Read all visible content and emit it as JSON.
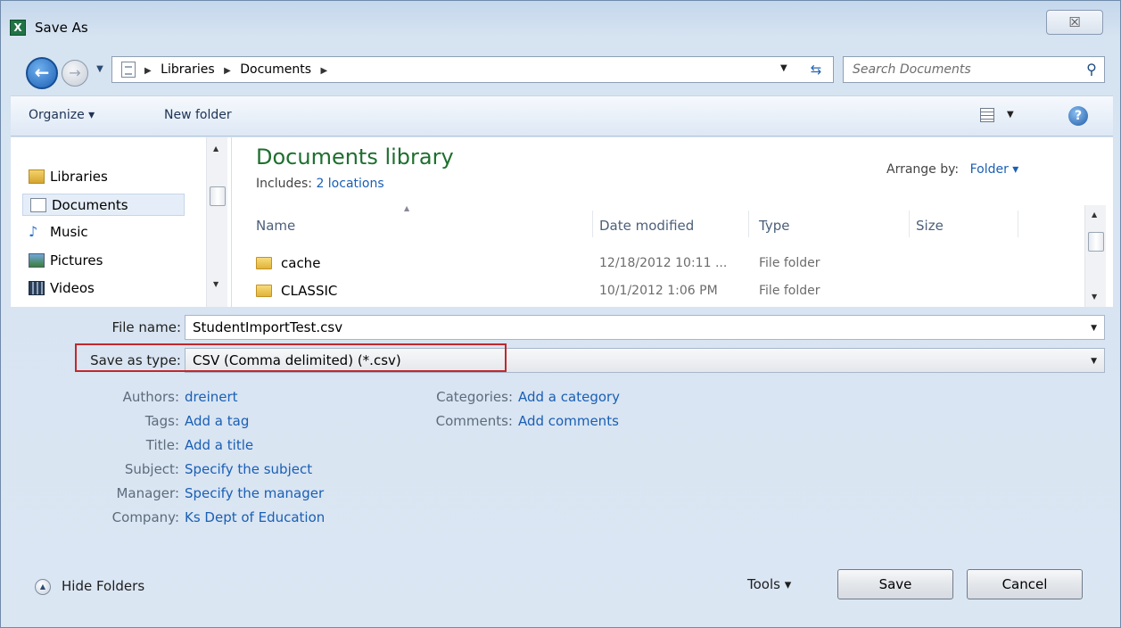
{
  "window": {
    "title": "Save As",
    "close_label": "☒",
    "app_icon_letter": "X"
  },
  "address": {
    "crumbs": [
      "Libraries",
      "Documents"
    ],
    "search_placeholder": "Search Documents"
  },
  "toolbar": {
    "organize_label": "Organize ▾",
    "new_folder_label": "New folder"
  },
  "nav": {
    "items": [
      {
        "label": "Libraries",
        "icon": "library-icon"
      },
      {
        "label": "Documents",
        "icon": "documents-icon",
        "selected": true
      },
      {
        "label": "Music",
        "icon": "music-icon"
      },
      {
        "label": "Pictures",
        "icon": "pictures-icon"
      },
      {
        "label": "Videos",
        "icon": "videos-icon"
      }
    ]
  },
  "library": {
    "title": "Documents library",
    "includes_label": "Includes:",
    "includes_link": "2 locations",
    "arrange_label": "Arrange by:",
    "arrange_value": "Folder ▾"
  },
  "columns": {
    "name": "Name",
    "date_modified": "Date modified",
    "type": "Type",
    "size": "Size"
  },
  "files": [
    {
      "name": "cache",
      "date": "12/18/2012 10:11 ...",
      "type": "File folder"
    },
    {
      "name": "CLASSIC",
      "date": "10/1/2012 1:06 PM",
      "type": "File folder"
    }
  ],
  "form": {
    "file_name_label": "File name:",
    "file_name_value": "StudentImportTest.csv",
    "save_type_label": "Save as type:",
    "save_type_value": "CSV (Comma delimited) (*.csv)"
  },
  "metadata": {
    "authors_label": "Authors:",
    "authors_value": "dreinert",
    "tags_label": "Tags:",
    "tags_value": "Add a tag",
    "title_label": "Title:",
    "title_value": "Add a title",
    "subject_label": "Subject:",
    "subject_value": "Specify the subject",
    "manager_label": "Manager:",
    "manager_value": "Specify the manager",
    "company_label": "Company:",
    "company_value": "Ks Dept of Education",
    "categories_label": "Categories:",
    "categories_value": "Add a category",
    "comments_label": "Comments:",
    "comments_value": "Add comments"
  },
  "footer": {
    "hide_folders_label": "Hide Folders",
    "tools_label": "Tools ▾",
    "save_label": "Save",
    "cancel_label": "Cancel"
  },
  "colors": {
    "accent_link": "#1a5fb4",
    "library_title": "#1e6f2e",
    "highlight_box": "#c0282d"
  }
}
